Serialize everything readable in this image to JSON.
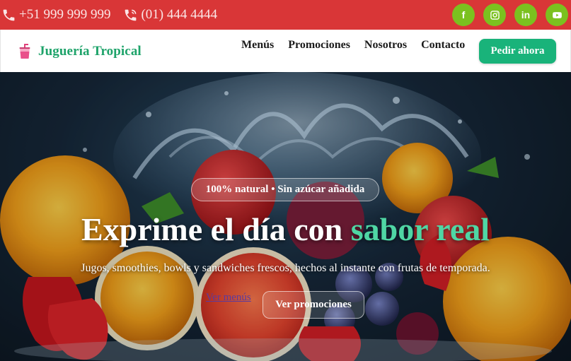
{
  "topbar": {
    "background": "#d93637",
    "phone_icon": "phone-icon",
    "phone": "+51 999 999 999",
    "landline_icon": "phone-volume-icon",
    "landline": "(01) 444 4444",
    "socials": [
      {
        "icon": "facebook-icon",
        "glyph": "f"
      },
      {
        "icon": "instagram-icon",
        "glyph": ""
      },
      {
        "icon": "linkedin-icon",
        "glyph": "in"
      },
      {
        "icon": "youtube-icon",
        "glyph": ""
      }
    ],
    "social_color": "#7bc11f"
  },
  "nav": {
    "brand_icon": "juice-cup-icon",
    "brand": "Juguería Tropical",
    "links": [
      "Menús",
      "Promociones",
      "Nosotros",
      "Contacto"
    ],
    "cta": "Pedir ahora",
    "brand_color": "#1ea36a",
    "cta_color": "#19b37a"
  },
  "hero": {
    "badge": "100% natural • Sin azúcar añadida",
    "headline_main": "Exprime el día con ",
    "headline_accent": "sabor real",
    "subtitle": "Jugos, smoothies, bowls y sandwiches frescos, hechos al instante con frutas de temporada.",
    "link": "Ver menús",
    "button": "Ver promociones",
    "accent_color": "#4fd6a4"
  }
}
